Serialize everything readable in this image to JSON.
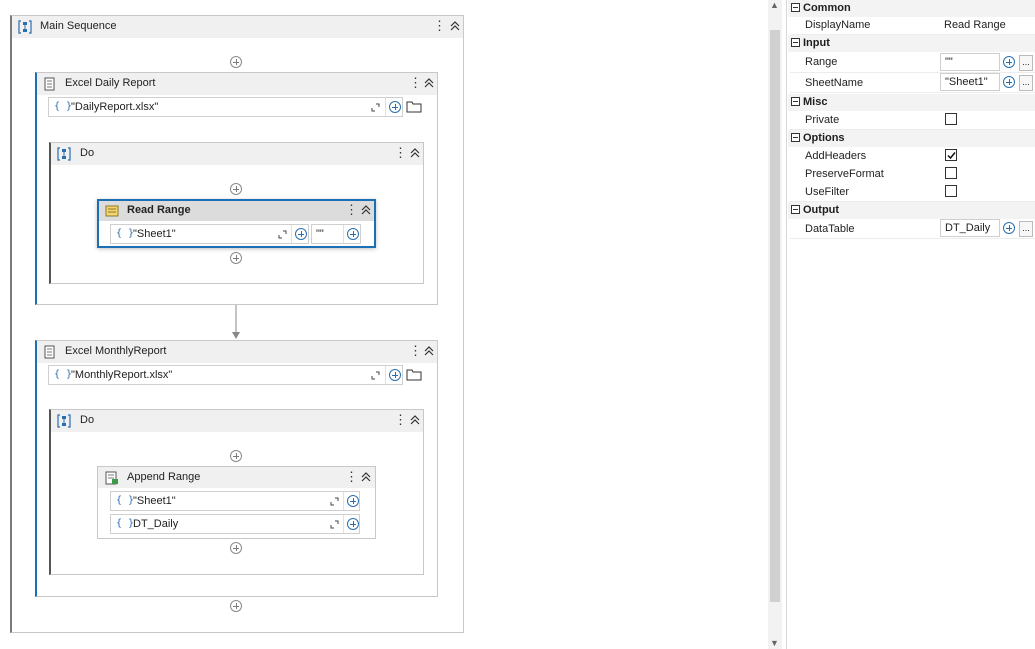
{
  "main_sequence": {
    "title": "Main Sequence"
  },
  "excel_daily": {
    "title": "Excel Daily Report",
    "path_value": "\"DailyReport.xlsx\""
  },
  "do_daily": {
    "title": "Do"
  },
  "read_range": {
    "title": "Read Range",
    "sheet_value": "\"Sheet1\"",
    "range_value": "\"\""
  },
  "excel_monthly": {
    "title": "Excel MonthlyReport",
    "path_value": "\"MonthlyReport.xlsx\""
  },
  "do_monthly": {
    "title": "Do"
  },
  "append_range": {
    "title": "Append Range",
    "sheet_value": "\"Sheet1\"",
    "datatable_value": "DT_Daily"
  },
  "brace_glyph": "{ }",
  "properties": {
    "common": {
      "label": "Common",
      "display_name_label": "DisplayName",
      "display_name_value": "Read Range"
    },
    "input": {
      "label": "Input",
      "range_label": "Range",
      "range_value": "\"\"",
      "sheet_label": "SheetName",
      "sheet_value": "\"Sheet1\""
    },
    "misc": {
      "label": "Misc",
      "private_label": "Private",
      "private_checked": false
    },
    "options": {
      "label": "Options",
      "add_headers_label": "AddHeaders",
      "add_headers_checked": true,
      "preserve_format_label": "PreserveFormat",
      "preserve_format_checked": false,
      "use_filter_label": "UseFilter",
      "use_filter_checked": false
    },
    "output": {
      "label": "Output",
      "datatable_label": "DataTable",
      "datatable_value": "DT_Daily"
    },
    "ellipsis": "..."
  },
  "colors": {
    "accent": "#1a6fb5",
    "selection_border": "#1a6fb5",
    "header_bg": "#f0f0f0"
  }
}
